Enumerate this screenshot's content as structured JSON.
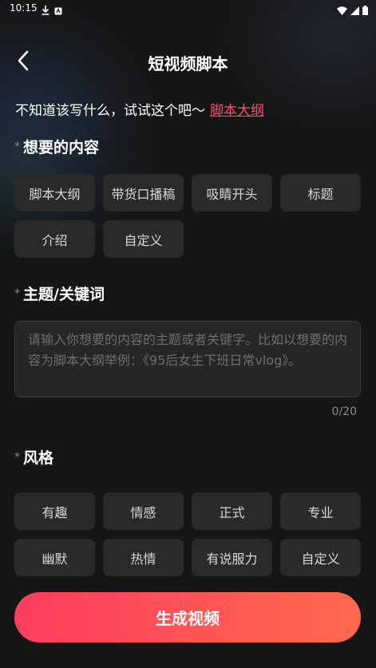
{
  "status_bar": {
    "time": "10:15",
    "icons_left": [
      "download-icon",
      "app-notification-icon"
    ],
    "icons_right": [
      "wifi-icon",
      "signal-icon",
      "battery-icon"
    ]
  },
  "header": {
    "title": "短视频脚本",
    "back_icon": "chevron-left-icon"
  },
  "hint": {
    "text": "不知道该写什么，试试这个吧～",
    "link": "脚本大纲"
  },
  "content_section": {
    "label": "想要的内容",
    "chips": [
      "脚本大纲",
      "带货口播稿",
      "吸睛开头",
      "标题",
      "介绍",
      "自定义"
    ]
  },
  "topic_section": {
    "label": "主题/关键词",
    "placeholder": "请输入你想要的内容的主题或者关键字。比如以想要的内容为脚本大纲举例：《95后女生下班日常vlog》。",
    "value": "",
    "char_count": "0/20"
  },
  "style_section": {
    "label": "风格",
    "chips": [
      "有趣",
      "情感",
      "正式",
      "专业",
      "幽默",
      "热情",
      "有说服力",
      "自定义"
    ]
  },
  "generate_button": {
    "label": "生成视频"
  },
  "colors": {
    "background": "#161616",
    "chip_bg": "#2a2a2a",
    "accent_link": "#ff4d6a",
    "button_gradient_start": "#ff3c5f",
    "button_gradient_end": "#ff6a4d"
  }
}
